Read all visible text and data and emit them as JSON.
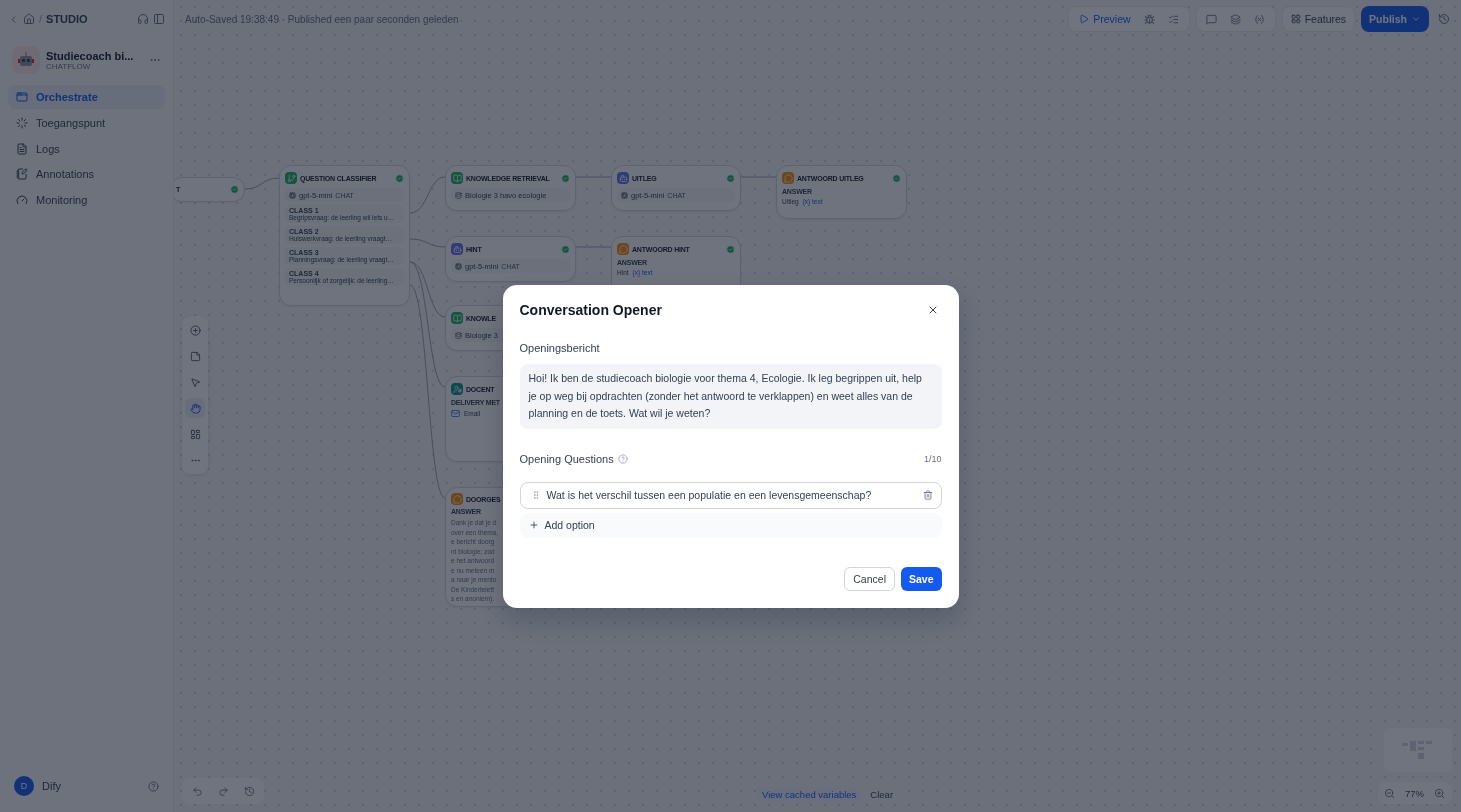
{
  "sidebar": {
    "breadcrumb_separator": "/",
    "breadcrumb": "STUDIO",
    "app_name": "Studiecoach bi...",
    "app_type": "CHATFLOW",
    "nav": [
      {
        "label": "Orchestrate",
        "selected": true
      },
      {
        "label": "Toegangspunt",
        "selected": false
      },
      {
        "label": "Logs",
        "selected": false
      },
      {
        "label": "Annotations",
        "selected": false
      },
      {
        "label": "Monitoring",
        "selected": false
      }
    ],
    "user": {
      "initial": "D",
      "name": "Dify"
    }
  },
  "header": {
    "status": "Auto-Saved 19:38:49 · Published een paar seconden geleden",
    "preview": "Preview",
    "features": "Features",
    "publish": "Publish"
  },
  "nodes": [
    {
      "kind": "start",
      "title": "T"
    },
    {
      "kind": "classifier",
      "title": "QUESTION CLASSIFIER",
      "model": "gpt-5-mini",
      "tag": "CHAT",
      "classes": [
        {
          "name": "CLASS 1",
          "text": "Begripsvraag: de leerling wil iets u…"
        },
        {
          "name": "CLASS 2",
          "text": "Huiswerkvraag: de leerling vraagt…"
        },
        {
          "name": "CLASS 3",
          "text": "Planningsvraag: de leerling vraagt…"
        },
        {
          "name": "CLASS 4",
          "text": "Persoonlijk of zorgelijk: de leerling…"
        }
      ]
    },
    {
      "kind": "knowledge",
      "title": "KNOWLEDGE RETRIEVAL",
      "dataset": "Biologie 3 havo ecologie"
    },
    {
      "kind": "llm",
      "title": "UITLEG",
      "model": "gpt-5-mini",
      "tag": "CHAT"
    },
    {
      "kind": "answer",
      "title": "ANTWOORD UITLEG",
      "label": "ANSWER",
      "source": "Uitleg",
      "variable": "{x} text"
    },
    {
      "kind": "llm",
      "title": "HINT",
      "model": "gpt-5-mini",
      "tag": "CHAT"
    },
    {
      "kind": "answer",
      "title": "ANTWOORD HINT",
      "label": "ANSWER",
      "source": "Hint",
      "variable": "{x} text"
    },
    {
      "kind": "knowledge",
      "title": "KNOWLE",
      "dataset": "Biologie 3"
    },
    {
      "kind": "email",
      "title": "DOCENT",
      "label": "DELIVERY MET",
      "method": "Email"
    },
    {
      "kind": "text",
      "title": "DOORGES",
      "label": "ANSWER",
      "lines": [
        "Dank je dat je d",
        "over een thema,",
        "e bericht doorg",
        "nt biologie; zod",
        "e het antwoord",
        "e nu meteen m",
        "a naar je mento",
        "De Kinderteleft",
        "s en anoniem)."
      ]
    }
  ],
  "footer": {
    "cached": "View cached variables",
    "clear": "Clear",
    "zoom": "77%"
  },
  "dialog": {
    "title": "Conversation Opener",
    "message_label": "Openingsbericht",
    "message": "Hoi! Ik ben de studiecoach biologie voor thema 4, Ecologie. Ik leg begrippen uit, help je op weg bij opdrachten (zonder het antwoord te verklappen) en weet alles van de planning en de toets. Wat wil je weten?",
    "questions_label": "Opening Questions",
    "count": "1/10",
    "questions": [
      "Wat is het verschil tussen een populatie en een levensgemeenschap?"
    ],
    "add": "Add option",
    "cancel": "Cancel",
    "save": "Save"
  }
}
